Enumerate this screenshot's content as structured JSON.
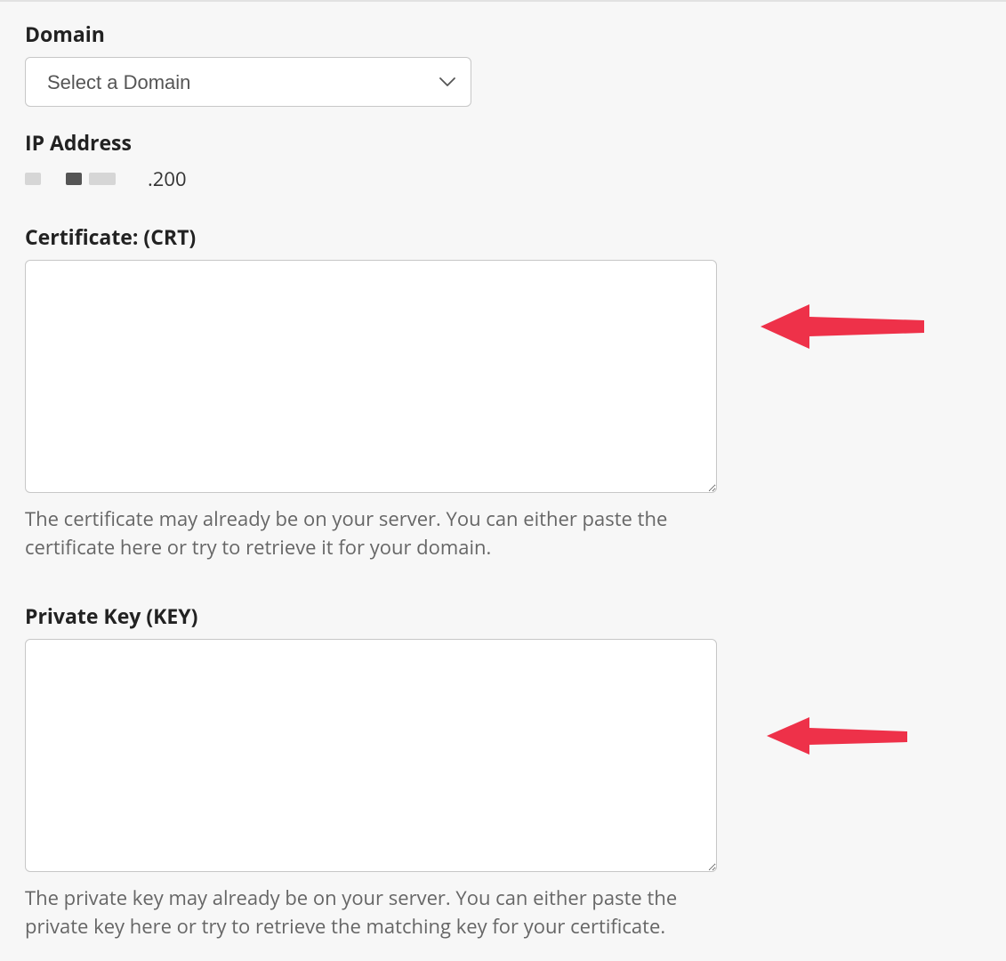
{
  "domain_section": {
    "label": "Domain",
    "placeholder": "Select a Domain"
  },
  "ip_section": {
    "label": "IP Address",
    "visible_suffix": ".200"
  },
  "certificate_section": {
    "label": "Certificate: (CRT)",
    "value": "",
    "help": "The certificate may already be on your server. You can either paste the certificate here or try to retrieve it for your domain."
  },
  "private_key_section": {
    "label": "Private Key (KEY)",
    "value": "",
    "help": "The private key may already be on your server. You can either paste the private key here or try to retrieve the matching key for your certificate."
  },
  "annotation": {
    "arrow_color": "#ee3149"
  }
}
